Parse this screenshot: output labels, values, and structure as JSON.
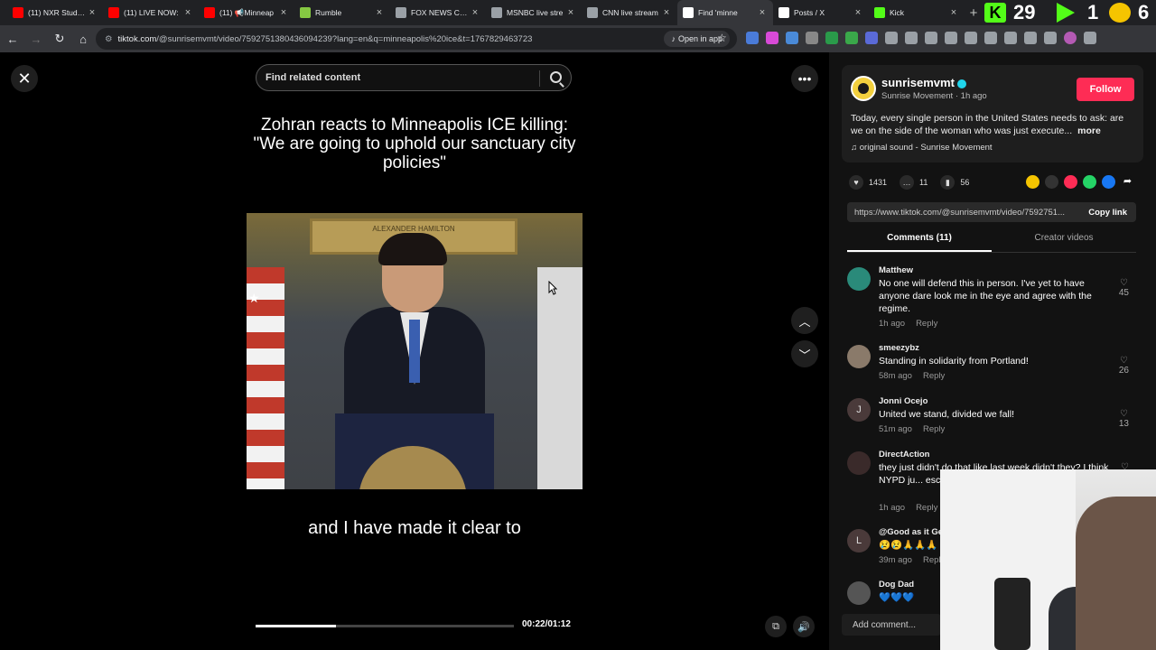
{
  "browser": {
    "tabs": [
      {
        "title": "(11) NXR Studios",
        "icon_color": "#ff0000"
      },
      {
        "title": "(11) LIVE NOW:",
        "icon_color": "#ff0000"
      },
      {
        "title": "(11) 📢Minneap",
        "icon_color": "#ff0000"
      },
      {
        "title": "Rumble",
        "icon_color": "#85c742"
      },
      {
        "title": "FOX NEWS CHA",
        "icon_color": "#9aa0a6"
      },
      {
        "title": "MSNBC live stre",
        "icon_color": "#9aa0a6"
      },
      {
        "title": "CNN live stream",
        "icon_color": "#9aa0a6"
      },
      {
        "title": "Find 'minne",
        "icon_color": "#ffffff"
      },
      {
        "title": "Posts / X",
        "icon_color": "#ffffff"
      },
      {
        "title": "Kick",
        "icon_color": "#53fc18"
      }
    ],
    "new_tab": "+",
    "overlay_counters": [
      "29",
      "1",
      "6"
    ],
    "url_host": "tiktok.com",
    "url_rest": "/@sunrisemvmt/video/7592751380436094239?lang=en&q=minneapolis%20ice&t=1767829463723",
    "open_in_app": "Open in app"
  },
  "video": {
    "search_placeholder": "Find related content",
    "headline": "Zohran reacts to Minneapolis ICE killing: \"We are going to uphold our sanctuary city policies\"",
    "plaque_text": "ALEXANDER HAMILTON",
    "caption": "and I have made it clear to",
    "timecode": "00:22/01:12",
    "progress": 0.31
  },
  "post": {
    "username": "sunrisemvmt",
    "display_name": "Sunrise Movement",
    "posted": "1h ago",
    "follow_label": "Follow",
    "description": "Today, every single person in the United States needs to ask: are we on the side of the woman who was just execute...",
    "more_label": "more",
    "sound": "original sound - Sunrise Movement",
    "likes": "1431",
    "comments_count": "11",
    "saves": "56",
    "link": "https://www.tiktok.com/@sunrisemvmt/video/7592751...",
    "copy_link": "Copy link"
  },
  "panel_tabs": [
    "Comments (11)",
    "Creator videos"
  ],
  "comments": [
    {
      "name": "Matthew",
      "text": "No one will defend this in person. I've yet to have anyone dare look me in the eye and agree with the regime.",
      "time": "1h ago",
      "likes": "45",
      "avatar": "",
      "avatar_color": "#2a8a7a"
    },
    {
      "name": "smeezybz",
      "text": "Standing in solidarity from Portland!",
      "time": "58m ago",
      "likes": "26",
      "avatar": "",
      "avatar_color": "#8a7a6a"
    },
    {
      "name": "Jonni Ocejo",
      "text": "United we stand, divided we fall!",
      "time": "51m ago",
      "likes": "13",
      "avatar": "J",
      "avatar_color": "#4a3a3a"
    },
    {
      "name": "DirectAction",
      "text": "they just didn't do that like last week didn't they? I think NYPD ju... escape protes...",
      "time": "1h ago",
      "likes": "",
      "avatar": "",
      "avatar_color": "#3a2a2a"
    },
    {
      "name": "@Good as it Ge",
      "text": "😢😢🙏🙏🙏",
      "time": "39m ago",
      "likes": "",
      "avatar": "L",
      "avatar_color": "#4a3a3a"
    },
    {
      "name": "Dog Dad",
      "text": "💙💙💙",
      "time": "",
      "likes": "",
      "avatar": "",
      "avatar_color": "#555555"
    }
  ],
  "reply_label": "Reply",
  "add_comment_placeholder": "Add comment..."
}
